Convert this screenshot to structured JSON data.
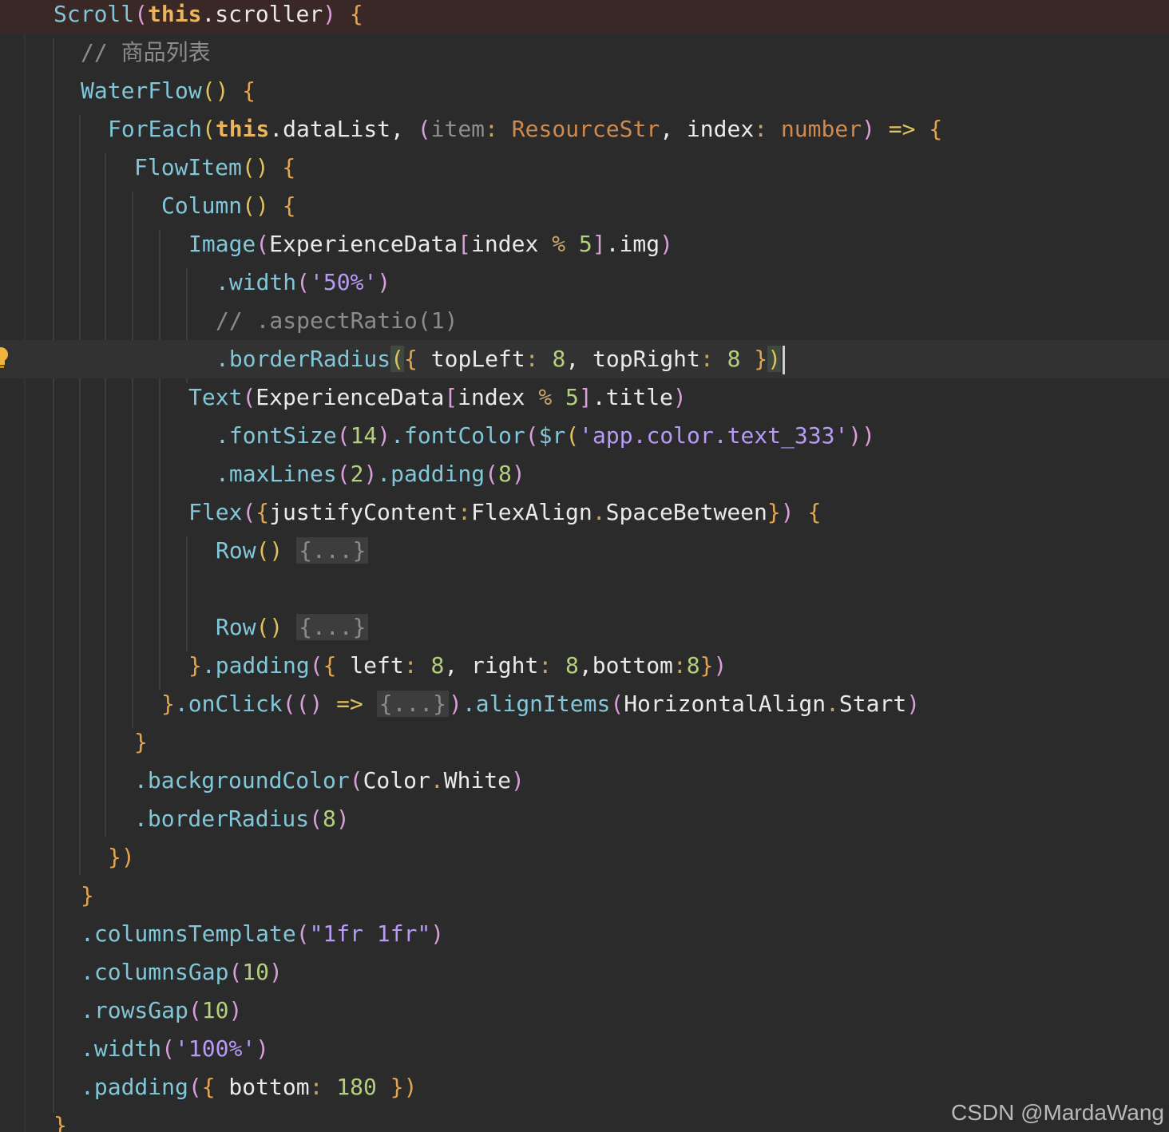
{
  "editor": {
    "lines": [
      {
        "tokens": [
          "Scroll",
          "(",
          "this",
          ".scroller",
          ")",
          " {"
        ]
      },
      {
        "tokens": [
          "// 商品列表"
        ]
      },
      {
        "tokens": [
          "WaterFlow",
          "()",
          " {"
        ]
      },
      {
        "tokens": [
          "ForEach",
          "(",
          "this",
          ".dataList, ",
          "(",
          "item",
          ": ",
          "ResourceStr",
          ", index",
          ": ",
          "number",
          ")",
          " => ",
          "{"
        ]
      },
      {
        "tokens": [
          "FlowItem",
          "()",
          " {"
        ]
      },
      {
        "tokens": [
          "Column",
          "()",
          " {"
        ]
      },
      {
        "tokens": [
          "Image",
          "(",
          "ExperienceData",
          "[",
          "index ",
          "% ",
          "5",
          "]",
          ".img",
          ")"
        ]
      },
      {
        "tokens": [
          ".width",
          "(",
          "'50%'",
          ")"
        ]
      },
      {
        "tokens": [
          "// .aspectRatio(1)"
        ]
      },
      {
        "tokens": [
          ".borderRadius",
          "(",
          "{",
          " topLeft",
          ": ",
          "8",
          ", topRight",
          ": ",
          "8",
          " }",
          ")"
        ]
      },
      {
        "tokens": [
          "Text",
          "(",
          "ExperienceData",
          "[",
          "index ",
          "% ",
          "5",
          "]",
          ".title",
          ")"
        ]
      },
      {
        "tokens": [
          ".fontSize",
          "(",
          "14",
          ")",
          ".fontColor",
          "(",
          "$r",
          "(",
          "'app.color.text_333'",
          "))"
        ]
      },
      {
        "tokens": [
          ".maxLines",
          "(",
          "2",
          ")",
          ".padding",
          "(",
          "8",
          ")"
        ]
      },
      {
        "tokens": [
          "Flex",
          "(",
          "{",
          "justifyContent",
          ":",
          "FlexAlign",
          ".",
          "SpaceBetween",
          "}",
          ")",
          " {"
        ]
      },
      {
        "tokens": [
          "Row",
          "()",
          " ",
          "{...}"
        ]
      },
      {
        "tokens": [
          "Row",
          "()",
          " ",
          "{...}"
        ]
      },
      {
        "tokens": [
          "}",
          ".padding",
          "(",
          "{",
          " left",
          ": ",
          "8",
          ", right",
          ": ",
          "8",
          ",bottom",
          ":",
          "8",
          "}",
          ")"
        ]
      },
      {
        "tokens": [
          "}",
          ".onClick",
          "((",
          ")",
          " => ",
          "{...}",
          ")",
          ".alignItems",
          "(",
          "HorizontalAlign",
          ".",
          "Start",
          ")"
        ]
      },
      {
        "tokens": [
          "}"
        ]
      },
      {
        "tokens": [
          ".backgroundColor",
          "(",
          "Color",
          ".",
          "White",
          ")"
        ]
      },
      {
        "tokens": [
          ".borderRadius",
          "(",
          "8",
          ")"
        ]
      },
      {
        "tokens": [
          "})"
        ]
      },
      {
        "tokens": [
          "}"
        ]
      },
      {
        "tokens": [
          ".columnsTemplate",
          "(",
          "\"1fr 1fr\"",
          ")"
        ]
      },
      {
        "tokens": [
          ".columnsGap",
          "(",
          "10",
          ")"
        ]
      },
      {
        "tokens": [
          ".rowsGap",
          "(",
          "10",
          ")"
        ]
      },
      {
        "tokens": [
          ".width",
          "(",
          "'100%'",
          ")"
        ]
      },
      {
        "tokens": [
          ".padding",
          "(",
          "{",
          " bottom",
          ": ",
          "180",
          " })"
        ]
      },
      {
        "tokens": [
          "}"
        ]
      }
    ]
  },
  "icons": {
    "bulb": "lightbulb-icon"
  },
  "watermark": "CSDN @MardaWang",
  "colors": {
    "background": "#2b2b2b",
    "function": "#81c7d8",
    "keyword": "#e9b460",
    "string": "#b79bf7",
    "number": "#b4d07c",
    "comment": "#8c8c8c",
    "type": "#d08a4e"
  }
}
